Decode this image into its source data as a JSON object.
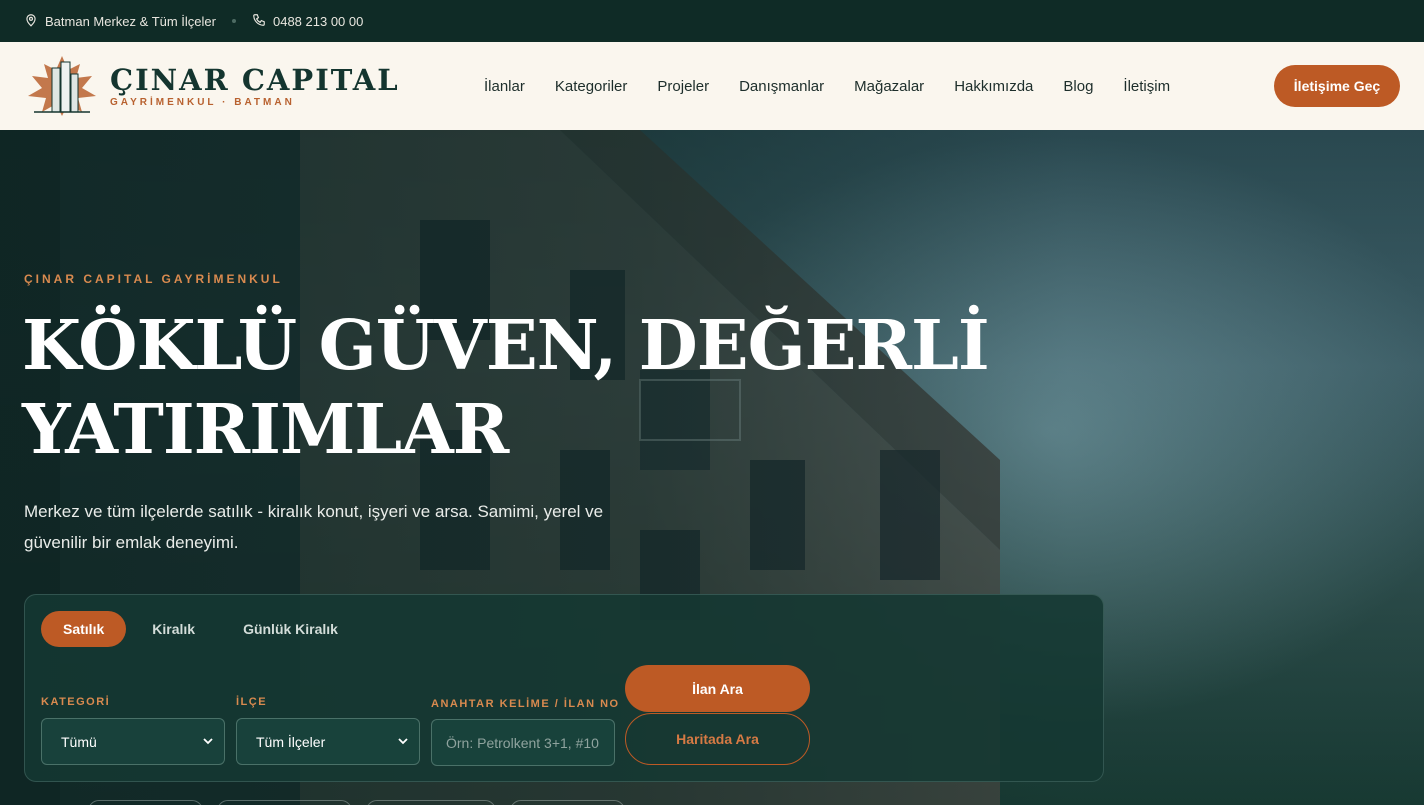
{
  "topbar": {
    "location": "Batman Merkez & Tüm İlçeler",
    "phone": "0488 213 00 00"
  },
  "brand": {
    "name": "ÇINAR CAPITAL",
    "tagline": "GAYRİMENKUL · BATMAN"
  },
  "nav": {
    "items": [
      "İlanlar",
      "Kategoriler",
      "Projeler",
      "Danışmanlar",
      "Mağazalar",
      "Hakkımızda",
      "Blog",
      "İletişim"
    ],
    "cta": "İletişime Geç"
  },
  "hero": {
    "eyebrow": "ÇINAR CAPITAL GAYRİMENKUL",
    "headline_line1": "KÖKLÜ GÜVEN, DEĞERLİ",
    "headline_line2": "YATIRIMLAR",
    "lead": "Merkez ve tüm ilçelerde satılık - kiralık konut, işyeri ve arsa. Samimi, yerel ve güvenilir bir emlak deneyimi."
  },
  "search": {
    "tabs": [
      "Satılık",
      "Kiralık",
      "Günlük Kiralık"
    ],
    "active_tab": "Satılık",
    "category_label": "KATEGORİ",
    "category_value": "Tümü",
    "district_label": "İLÇE",
    "district_value": "Tüm İlçeler",
    "keyword_label": "ANAHTAR KELİME / İLAN NO",
    "keyword_placeholder": "Örn: Petrolkent 3+1, #10",
    "search_button": "İlan Ara",
    "map_button": "Haritada Ara"
  },
  "colors": {
    "accent": "#bd5a25",
    "dark": "#0f2b26",
    "cream": "#faf6ee"
  }
}
